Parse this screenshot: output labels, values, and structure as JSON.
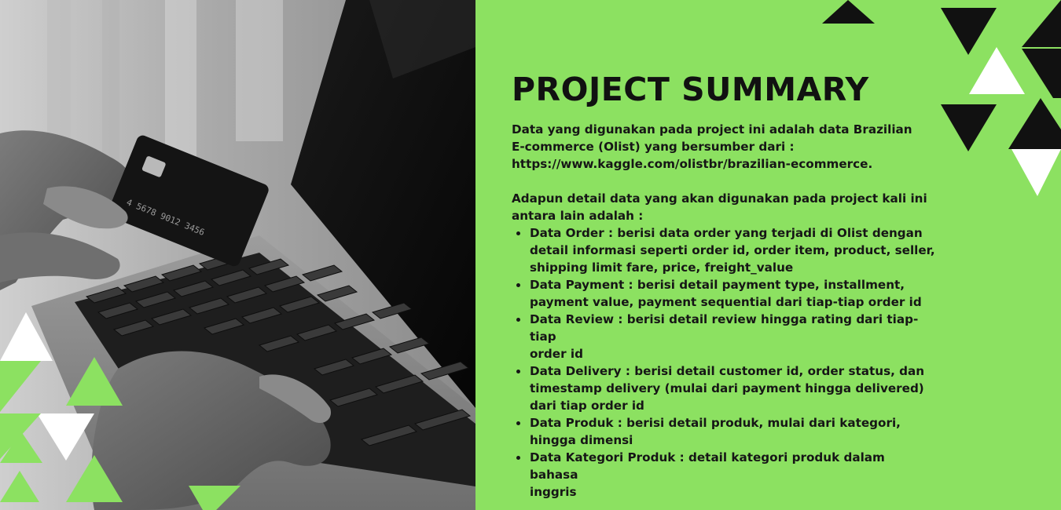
{
  "slide": {
    "title": "PROJECT SUMMARY",
    "intro": [
      "Data yang digunakan pada project ini adalah data Brazilian",
      "E-commerce (Olist) yang bersumber dari :",
      "https://www.kaggle.com/olistbr/brazilian-ecommerce."
    ],
    "details_intro": [
      "Adapun detail data yang akan digunakan pada project kali ini",
      "antara lain adalah :"
    ],
    "details": [
      {
        "lines": [
          "Data Order : berisi data order yang terjadi di Olist dengan",
          "detail informasi seperti order id, order item, product, seller,",
          "shipping limit fare, price, freight_value"
        ]
      },
      {
        "lines": [
          "Data Payment : berisi detail payment type, installment,",
          "payment value, payment sequential dari tiap-tiap order id"
        ]
      },
      {
        "lines": [
          "Data Review : berisi detail review hingga rating dari tiap-tiap",
          "order id"
        ]
      },
      {
        "lines": [
          "Data Delivery : berisi detail customer id, order status, dan",
          "timestamp delivery (mulai dari payment hingga delivered)",
          "dari tiap order id"
        ]
      },
      {
        "lines": [
          "Data Produk : berisi detail produk, mulai dari kategori,",
          "hingga dimensi"
        ]
      },
      {
        "lines": [
          "Data Kategori Produk : detail kategori produk dalam bahasa",
          "inggris"
        ]
      }
    ],
    "card_number": "4 5678 9012 3456"
  },
  "colors": {
    "background": "#8ce161",
    "text": "#111111",
    "accent_black": "#111111",
    "accent_white": "#ffffff"
  }
}
